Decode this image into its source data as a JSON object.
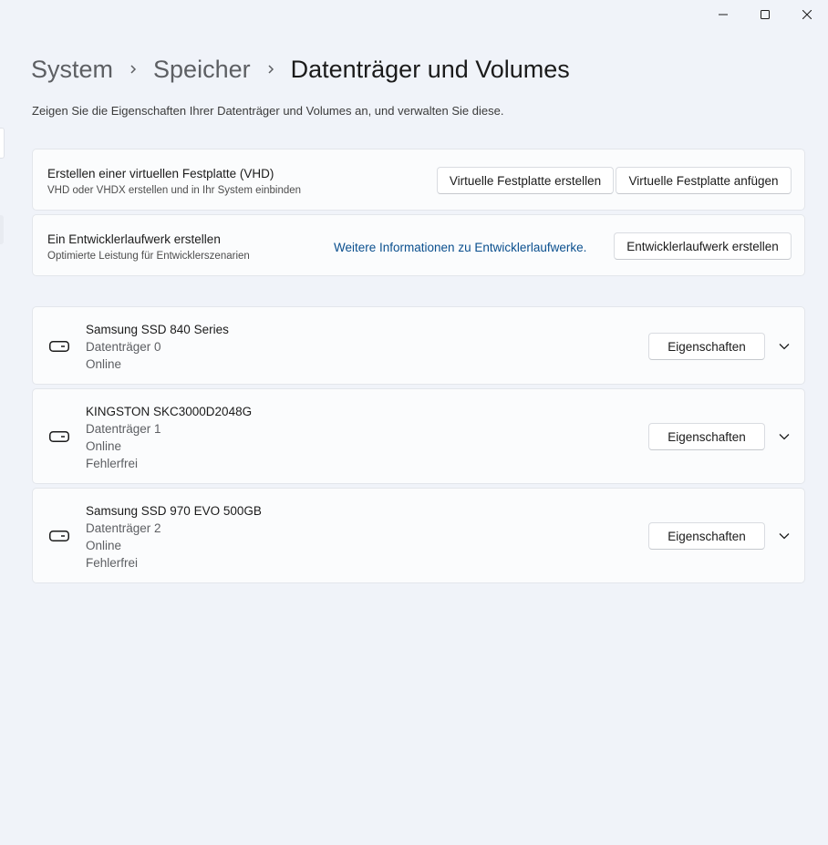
{
  "window": {
    "controls": {
      "minimize_icon": "minimize-icon",
      "maximize_icon": "maximize-icon",
      "close_icon": "close-icon"
    }
  },
  "breadcrumb": {
    "items": [
      "System",
      "Speicher",
      "Datenträger und Volumes"
    ]
  },
  "page": {
    "description": "Zeigen Sie die Eigenschaften Ihrer Datenträger und Volumes an, und verwalten Sie diese."
  },
  "vhd_card": {
    "title": "Erstellen einer virtuellen Festplatte (VHD)",
    "subtitle": "VHD oder VHDX erstellen und in Ihr System einbinden",
    "create_button": "Virtuelle Festplatte erstellen",
    "attach_button": "Virtuelle Festplatte anfügen"
  },
  "dev_card": {
    "title": "Ein Entwicklerlaufwerk erstellen",
    "subtitle": "Optimierte Leistung für Entwicklerszenarien",
    "link": "Weitere Informationen zu Entwicklerlaufwerke.",
    "create_button": "Entwicklerlaufwerk erstellen"
  },
  "disks": [
    {
      "name": "Samsung SSD 840 Series",
      "details": [
        "Datenträger 0",
        "Online"
      ],
      "properties_button": "Eigenschaften",
      "icon": "drive-icon"
    },
    {
      "name": "KINGSTON SKC3000D2048G",
      "details": [
        "Datenträger 1",
        "Online",
        "Fehlerfrei"
      ],
      "properties_button": "Eigenschaften",
      "icon": "drive-icon"
    },
    {
      "name": "Samsung SSD 970 EVO 500GB",
      "details": [
        "Datenträger 2",
        "Online",
        "Fehlerfrei"
      ],
      "properties_button": "Eigenschaften",
      "icon": "drive-icon"
    }
  ],
  "colors": {
    "background": "#f0f3f9",
    "card": "#fbfcfd",
    "link": "#0a4f8e",
    "text_primary": "#1b1b1b",
    "text_secondary": "#5d5f63"
  }
}
